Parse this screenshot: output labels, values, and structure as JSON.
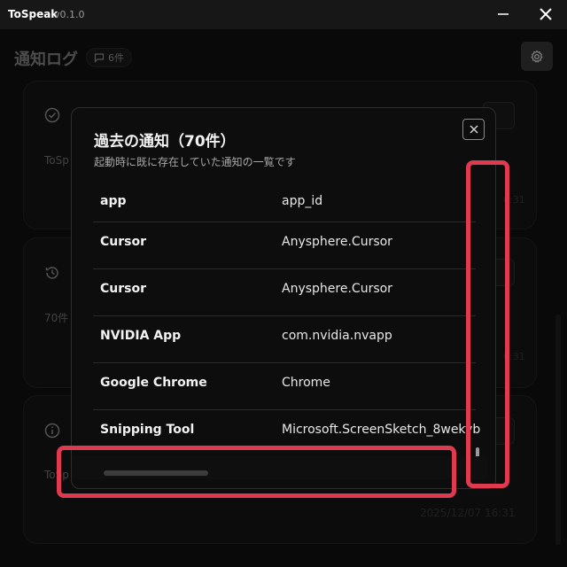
{
  "window": {
    "title": "ToSpeak",
    "version": "v0.1.0"
  },
  "header": {
    "title": "通知ログ",
    "count_label": "6件"
  },
  "cards": [
    {
      "text_fragment": "ToSp",
      "time_fragment": "6:31"
    },
    {
      "text_fragment": "70件",
      "time_fragment": "6:31"
    },
    {
      "text_fragment": "ToSp",
      "timestamp": "2025/12/07 16:31"
    }
  ],
  "modal": {
    "title": "過去の通知（70件）",
    "subtitle": "起動時に既に存在していた通知の一覧です",
    "columns": {
      "app": "app",
      "app_id": "app_id"
    },
    "rows": [
      {
        "app": "Cursor",
        "app_id": "Anysphere.Cursor"
      },
      {
        "app": "Cursor",
        "app_id": "Anysphere.Cursor"
      },
      {
        "app": "NVIDIA App",
        "app_id": "com.nvidia.nvapp"
      },
      {
        "app": "Google Chrome",
        "app_id": "Chrome"
      },
      {
        "app": "Snipping Tool",
        "app_id": "Microsoft.ScreenSketch_8wekyb"
      }
    ]
  },
  "colors": {
    "highlight": "#e03a50",
    "modal_bg": "#0d0d0d",
    "app_bg": "#111111"
  },
  "icons": [
    "minimize-icon",
    "close-icon",
    "message-icon",
    "gear-icon",
    "check-circle-icon",
    "history-icon",
    "info-icon",
    "clipboard-icon",
    "modal-close-icon"
  ]
}
